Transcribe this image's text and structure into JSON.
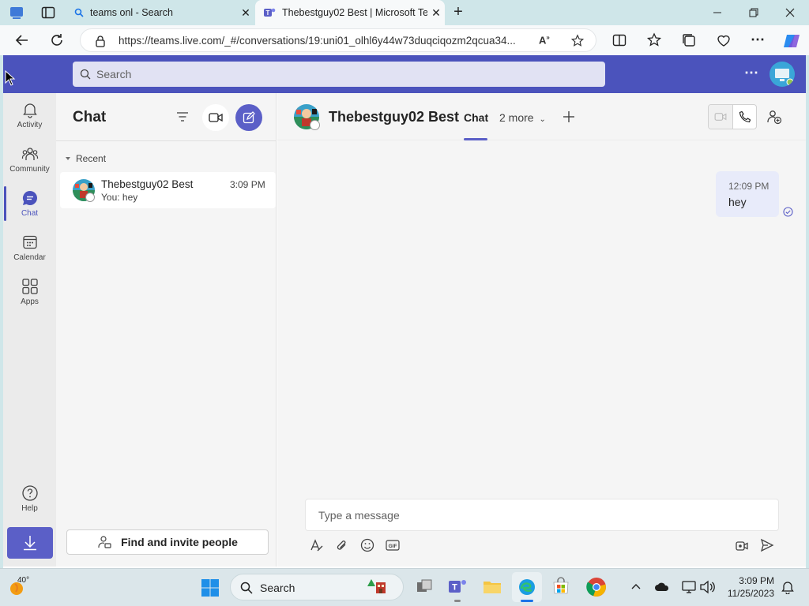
{
  "browser": {
    "tabs": [
      {
        "title": "teams onl - Search",
        "active": false
      },
      {
        "title": "Thebestguy02 Best | Microsoft Te",
        "active": true
      }
    ],
    "url": "https://teams.live.com/_#/conversations/19:uni01_olhl6y44w73duqciqozm2qcua34..."
  },
  "teams": {
    "search_placeholder": "Search",
    "rail": [
      {
        "label": "Activity",
        "icon": "bell-icon"
      },
      {
        "label": "Community",
        "icon": "community-icon"
      },
      {
        "label": "Chat",
        "icon": "chat-icon",
        "active": true
      },
      {
        "label": "Calendar",
        "icon": "calendar-icon"
      },
      {
        "label": "Apps",
        "icon": "apps-icon"
      }
    ],
    "help_label": "Help",
    "chat_panel": {
      "title": "Chat",
      "section": "Recent",
      "items": [
        {
          "name": "Thebestguy02 Best",
          "time": "3:09 PM",
          "preview": "You: hey"
        }
      ],
      "find_invite_label": "Find and invite people"
    },
    "conversation": {
      "title": "Thebestguy02 Best",
      "tabs": {
        "chat": "Chat",
        "more": "2 more"
      },
      "messages": [
        {
          "time": "12:09 PM",
          "text": "hey",
          "status": "seen"
        }
      ],
      "compose_placeholder": "Type a message"
    }
  },
  "taskbar": {
    "weather": "40°",
    "search_label": "Search",
    "time": "3:09 PM",
    "date": "11/25/2023"
  },
  "colors": {
    "teams_header": "#4b53bc",
    "accent": "#5b5fc7",
    "browser_frame": "#cfe6e9"
  }
}
